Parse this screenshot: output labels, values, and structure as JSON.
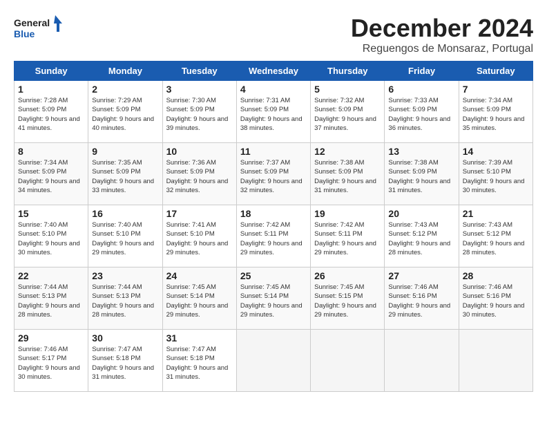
{
  "logo": {
    "text_general": "General",
    "text_blue": "Blue"
  },
  "title": "December 2024",
  "subtitle": "Reguengos de Monsaraz, Portugal",
  "weekdays": [
    "Sunday",
    "Monday",
    "Tuesday",
    "Wednesday",
    "Thursday",
    "Friday",
    "Saturday"
  ],
  "weeks": [
    [
      {
        "num": "1",
        "sunrise": "7:28 AM",
        "sunset": "5:09 PM",
        "daylight": "9 hours and 41 minutes."
      },
      {
        "num": "2",
        "sunrise": "7:29 AM",
        "sunset": "5:09 PM",
        "daylight": "9 hours and 40 minutes."
      },
      {
        "num": "3",
        "sunrise": "7:30 AM",
        "sunset": "5:09 PM",
        "daylight": "9 hours and 39 minutes."
      },
      {
        "num": "4",
        "sunrise": "7:31 AM",
        "sunset": "5:09 PM",
        "daylight": "9 hours and 38 minutes."
      },
      {
        "num": "5",
        "sunrise": "7:32 AM",
        "sunset": "5:09 PM",
        "daylight": "9 hours and 37 minutes."
      },
      {
        "num": "6",
        "sunrise": "7:33 AM",
        "sunset": "5:09 PM",
        "daylight": "9 hours and 36 minutes."
      },
      {
        "num": "7",
        "sunrise": "7:34 AM",
        "sunset": "5:09 PM",
        "daylight": "9 hours and 35 minutes."
      }
    ],
    [
      {
        "num": "8",
        "sunrise": "7:34 AM",
        "sunset": "5:09 PM",
        "daylight": "9 hours and 34 minutes."
      },
      {
        "num": "9",
        "sunrise": "7:35 AM",
        "sunset": "5:09 PM",
        "daylight": "9 hours and 33 minutes."
      },
      {
        "num": "10",
        "sunrise": "7:36 AM",
        "sunset": "5:09 PM",
        "daylight": "9 hours and 32 minutes."
      },
      {
        "num": "11",
        "sunrise": "7:37 AM",
        "sunset": "5:09 PM",
        "daylight": "9 hours and 32 minutes."
      },
      {
        "num": "12",
        "sunrise": "7:38 AM",
        "sunset": "5:09 PM",
        "daylight": "9 hours and 31 minutes."
      },
      {
        "num": "13",
        "sunrise": "7:38 AM",
        "sunset": "5:09 PM",
        "daylight": "9 hours and 31 minutes."
      },
      {
        "num": "14",
        "sunrise": "7:39 AM",
        "sunset": "5:10 PM",
        "daylight": "9 hours and 30 minutes."
      }
    ],
    [
      {
        "num": "15",
        "sunrise": "7:40 AM",
        "sunset": "5:10 PM",
        "daylight": "9 hours and 30 minutes."
      },
      {
        "num": "16",
        "sunrise": "7:40 AM",
        "sunset": "5:10 PM",
        "daylight": "9 hours and 29 minutes."
      },
      {
        "num": "17",
        "sunrise": "7:41 AM",
        "sunset": "5:10 PM",
        "daylight": "9 hours and 29 minutes."
      },
      {
        "num": "18",
        "sunrise": "7:42 AM",
        "sunset": "5:11 PM",
        "daylight": "9 hours and 29 minutes."
      },
      {
        "num": "19",
        "sunrise": "7:42 AM",
        "sunset": "5:11 PM",
        "daylight": "9 hours and 29 minutes."
      },
      {
        "num": "20",
        "sunrise": "7:43 AM",
        "sunset": "5:12 PM",
        "daylight": "9 hours and 28 minutes."
      },
      {
        "num": "21",
        "sunrise": "7:43 AM",
        "sunset": "5:12 PM",
        "daylight": "9 hours and 28 minutes."
      }
    ],
    [
      {
        "num": "22",
        "sunrise": "7:44 AM",
        "sunset": "5:13 PM",
        "daylight": "9 hours and 28 minutes."
      },
      {
        "num": "23",
        "sunrise": "7:44 AM",
        "sunset": "5:13 PM",
        "daylight": "9 hours and 28 minutes."
      },
      {
        "num": "24",
        "sunrise": "7:45 AM",
        "sunset": "5:14 PM",
        "daylight": "9 hours and 29 minutes."
      },
      {
        "num": "25",
        "sunrise": "7:45 AM",
        "sunset": "5:14 PM",
        "daylight": "9 hours and 29 minutes."
      },
      {
        "num": "26",
        "sunrise": "7:45 AM",
        "sunset": "5:15 PM",
        "daylight": "9 hours and 29 minutes."
      },
      {
        "num": "27",
        "sunrise": "7:46 AM",
        "sunset": "5:16 PM",
        "daylight": "9 hours and 29 minutes."
      },
      {
        "num": "28",
        "sunrise": "7:46 AM",
        "sunset": "5:16 PM",
        "daylight": "9 hours and 30 minutes."
      }
    ],
    [
      {
        "num": "29",
        "sunrise": "7:46 AM",
        "sunset": "5:17 PM",
        "daylight": "9 hours and 30 minutes."
      },
      {
        "num": "30",
        "sunrise": "7:47 AM",
        "sunset": "5:18 PM",
        "daylight": "9 hours and 31 minutes."
      },
      {
        "num": "31",
        "sunrise": "7:47 AM",
        "sunset": "5:18 PM",
        "daylight": "9 hours and 31 minutes."
      },
      null,
      null,
      null,
      null
    ]
  ]
}
